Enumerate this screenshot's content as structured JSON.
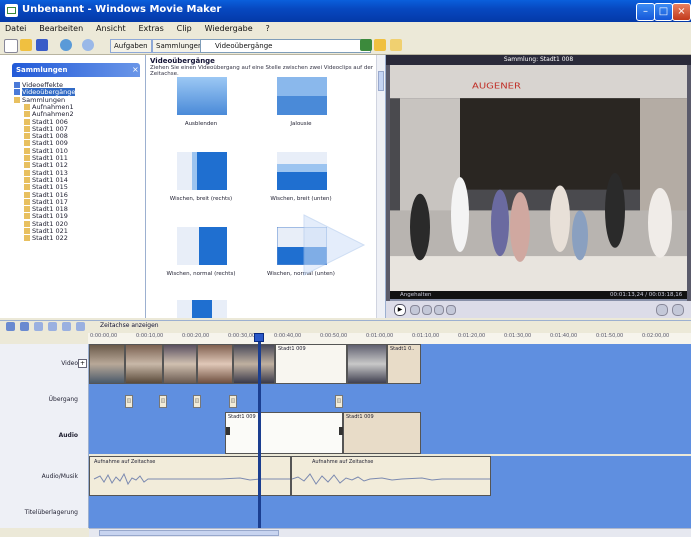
{
  "window": {
    "title": "Unbenannt - Windows Movie Maker",
    "colors": {
      "title_bar": "#0748c0",
      "track": "#5f8fe0",
      "playhead": "#1b3e90"
    }
  },
  "menu": [
    "Datei",
    "Bearbeiten",
    "Ansicht",
    "Extras",
    "Clip",
    "Wiedergabe",
    "?"
  ],
  "toolbar": {
    "tasks_label": "Aufgaben",
    "collections_label": "Sammlungen",
    "collection_select": "Videoübergänge"
  },
  "left_pane": {
    "header": "Sammlungen",
    "tree": [
      "Videoeffekte",
      "Videoübergänge",
      "Sammlungen",
      "Aufnahmen1",
      "Aufnahmen2",
      "Stadt1 006",
      "Stadt1 007",
      "Stadt1 008",
      "Stadt1 009",
      "Stadt1 010",
      "Stadt1 011",
      "Stadt1 012",
      "Stadt1 013",
      "Stadt1 014",
      "Stadt1 015",
      "Stadt1 016",
      "Stadt1 017",
      "Stadt1 018",
      "Stadt1 019",
      "Stadt1 020",
      "Stadt1 021",
      "Stadt1 022"
    ]
  },
  "transitions": {
    "title": "Videoübergänge",
    "description": "Ziehen Sie einen Videoübergang auf eine Stelle zwischen zwei Videoclips auf der Zeitachse.",
    "items": [
      {
        "label": "Ausblenden",
        "type": "fade"
      },
      {
        "label": "Jalousie",
        "type": "blinds"
      },
      {
        "label": "Wischen, breit (rechts)",
        "type": "wipe-right"
      },
      {
        "label": "Wischen, breit (unten)",
        "type": "wipe-down"
      },
      {
        "label": "Wischen, normal (rechts)",
        "type": "wipe-right2"
      },
      {
        "label": "Wischen, normal (unten)",
        "type": "wipe-down2"
      },
      {
        "label": "",
        "type": "bar"
      }
    ]
  },
  "preview": {
    "title": "Sammlung: Stadt1 008",
    "sign_text": "AUGENER",
    "status_left": "Angehalten",
    "status_right": "00:01:13,24 / 00:03:18,16"
  },
  "timeline": {
    "show_label": "Zeitachse anzeigen",
    "ruler": [
      "0:00:00,00",
      "0:00:10,00",
      "0:00:20,00",
      "0:00:30,00",
      "0:00:40,00",
      "0:00:50,00",
      "0:01:00,00",
      "0:01:10,00",
      "0:01:20,00",
      "0:01:30,00",
      "0:01:40,00",
      "0:01:50,00",
      "0:02:00,00"
    ],
    "tracks": {
      "video": "Video",
      "transition": "Übergang",
      "audio": "Audio",
      "audio_music": "Audio/Musik",
      "title_overlay": "Titelüberlagerung"
    },
    "clips": {
      "video_mid": "Stadt1 009",
      "video_last": "Stadt1 0..",
      "audio_a": "Stadt1 009",
      "audio_b": "Stadt1 009",
      "music_a": "Aufnahme auf Zeitachse",
      "music_b": "Aufnahme auf Zeitachse"
    }
  }
}
